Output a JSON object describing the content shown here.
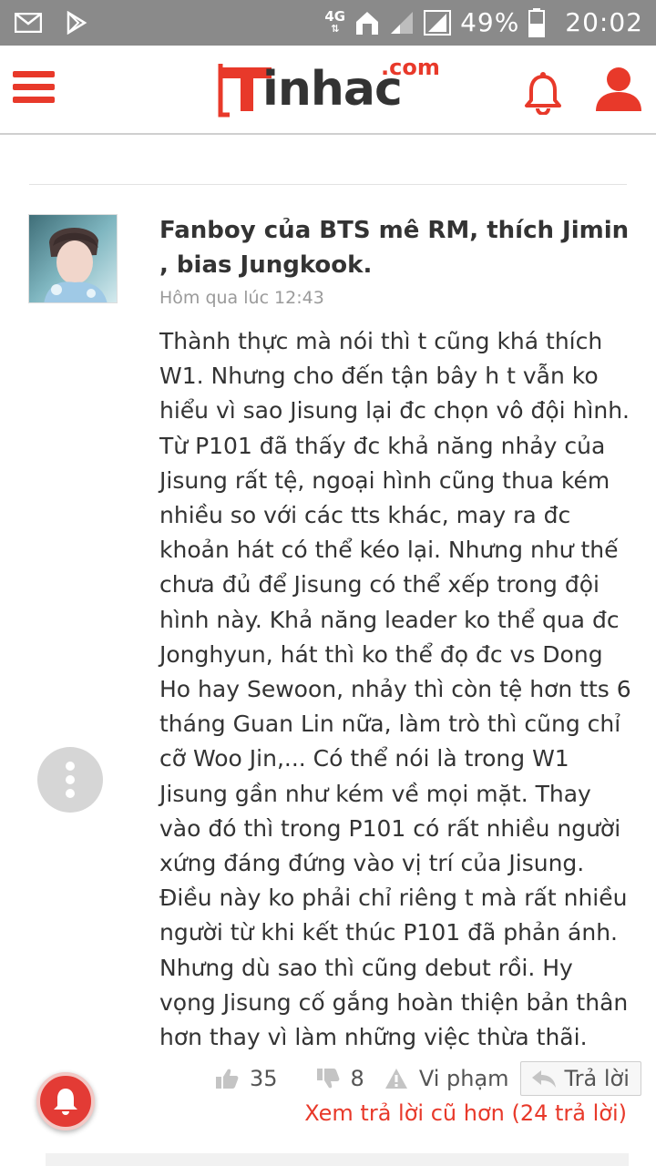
{
  "status_bar": {
    "network": "4G",
    "battery": "49%",
    "time": "20:02"
  },
  "header": {
    "logo_text": "inhac",
    "logo_domain": ".com",
    "accent_color": "#e8392a"
  },
  "comment": {
    "author": "Fanboy của BTS mê RM, thích Jimin , bias Jungkook.",
    "timestamp": "Hôm qua lúc 12:43",
    "paragraphs": [
      "Thành thực mà nói thì t cũng khá thích W1. Nhưng cho đến tận bây h t vẫn ko hiểu vì sao Jisung lại đc chọn vô đội hình. Từ P101 đã thấy đc khả năng nhảy của Jisung rất tệ, ngoại hình cũng thua kém nhiều so với các tts khác, may ra đc khoản hát có thể kéo lại. Nhưng như thế chưa đủ để Jisung có thể xếp trong đội hình này. Khả năng leader ko thể qua đc Jonghyun, hát thì ko thể đọ đc vs Dong Ho hay Sewoon, nhảy thì còn tệ hơn tts 6 tháng Guan Lin nữa, làm trò thì cũng chỉ cỡ Woo Jin,... Có thể nói là trong W1 Jisung gần như kém về mọi mặt. Thay vào đó thì trong P101 có rất nhiều người xứng đáng đứng vào vị trí của Jisung. Điều này ko phải chỉ riêng t mà rất nhiều người từ khi kết thúc P101 đã phản ánh.",
      "Nhưng dù sao thì cũng debut rồi. Hy vọng Jisung cố gắng hoàn thiện bản thân hơn thay vì làm những việc thừa thãi."
    ],
    "likes": "35",
    "dislikes": "8",
    "report_label": "Vi phạm",
    "reply_label": "Trả lời",
    "older_replies_link": "Xem trả lời cũ hơn (24 trả lời)"
  },
  "icons": {
    "menu": "hamburger-icon",
    "bell": "bell-icon",
    "user": "user-icon",
    "more": "more-vertical-icon",
    "like": "thumbs-up-icon",
    "dislike": "thumbs-down-icon",
    "report": "warning-icon",
    "reply": "reply-icon",
    "notification": "bell-icon"
  }
}
